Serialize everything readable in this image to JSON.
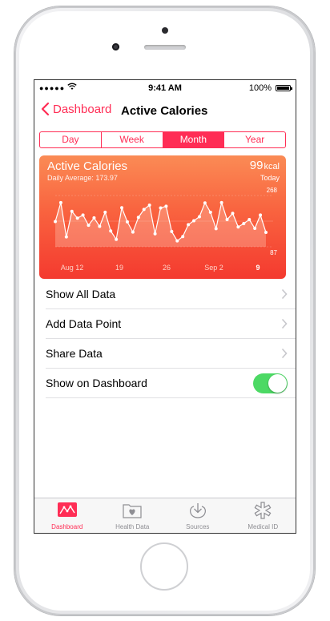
{
  "status": {
    "carrier": "●●●●●",
    "time": "9:41 AM",
    "battery": "100%"
  },
  "nav": {
    "back_label": "Dashboard",
    "title": "Active Calories"
  },
  "segments": {
    "items": [
      "Day",
      "Week",
      "Month",
      "Year"
    ],
    "selected": "Month"
  },
  "card": {
    "title": "Active Calories",
    "average": "Daily Average: 173.97",
    "value": "99",
    "unit": "kcal",
    "period": "Today"
  },
  "chart_data": {
    "type": "area",
    "ylim": [
      87,
      268
    ],
    "y_tick_labels": [
      "268",
      "87"
    ],
    "x_tick_labels": [
      "Aug 12",
      "19",
      "26",
      "Sep 2",
      "9"
    ],
    "series": [
      {
        "values": [
          176,
          243,
          122,
          212,
          188,
          199,
          163,
          189,
          159,
          209,
          143,
          113,
          225,
          175,
          139,
          191,
          219,
          234,
          133,
          224,
          230,
          141,
          108,
          123,
          165,
          179,
          193,
          242,
          209,
          151,
          243,
          183,
          205,
          157,
          169,
          183,
          152,
          199,
          138
        ]
      }
    ],
    "colors": {
      "background_top": "#fa8b55",
      "background_bottom": "#f43a2f",
      "line": "#ffffff"
    }
  },
  "actions": [
    {
      "label": "Show All Data"
    },
    {
      "label": "Add Data Point"
    },
    {
      "label": "Share Data"
    }
  ],
  "dashboard_toggle": {
    "label": "Show on Dashboard",
    "on": true
  },
  "tabs": [
    {
      "label": "Dashboard",
      "icon": "dashboard-chart-icon",
      "active": true
    },
    {
      "label": "Health Data",
      "icon": "health-data-folder-icon"
    },
    {
      "label": "Sources",
      "icon": "sources-download-icon"
    },
    {
      "label": "Medical ID",
      "icon": "medical-id-asterisk-icon"
    }
  ],
  "colors": {
    "accent": "#ff2d55",
    "toggle_on": "#4cd964"
  }
}
